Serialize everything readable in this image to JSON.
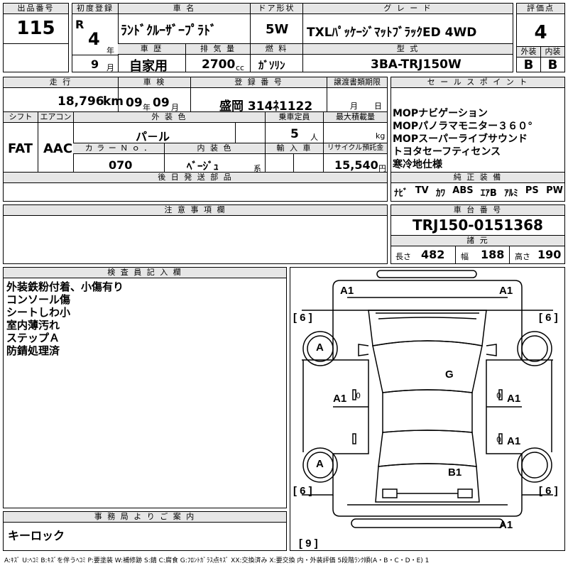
{
  "header": {
    "lot_label": "出品番号",
    "lot_no": "115",
    "first_reg_label": "初度登録",
    "era": "R",
    "year": "4",
    "year_unit": "年",
    "month": "9",
    "month_unit": "月",
    "name_label": "車 名",
    "car_name": "ﾗﾝﾄﾞｸﾙｰｻﾞｰﾌﾟﾗﾄﾞ",
    "door_label": "ドア形状",
    "door": "5W",
    "grade_label": "グ レ ー ド",
    "grade": "TXLﾊﾟｯｹｰｼﾞﾏｯﾄﾌﾞﾗｯｸED 4WD",
    "score_label": "評価点",
    "score": "4",
    "history_label": "車 歴",
    "history": "自家用",
    "displacement_label": "排 気 量",
    "displacement": "2700",
    "displacement_unit": "cc",
    "fuel_label": "燃 料",
    "fuel": "ｶﾞｿﾘﾝ",
    "model_label": "型 式",
    "model": "3BA-TRJ150W",
    "ext_label": "外装",
    "ext_grade": "B",
    "int_label": "内装",
    "int_grade": "B"
  },
  "row2": {
    "mileage_label": "走 行",
    "mileage": "18,796",
    "mileage_unit": "km",
    "inspection_label": "車 検",
    "insp_year": "09",
    "insp_year_unit": "年",
    "insp_month": "09",
    "insp_month_unit": "月",
    "plate_label": "登 録 番 号",
    "plate": "盛岡 314ﾈ1122",
    "transfer_label": "譲渡書類期限",
    "transfer_month": "月",
    "transfer_day": "日",
    "shift_label": "シフト",
    "shift": "FAT",
    "ac_label": "エアコン",
    "ac": "AAC",
    "color_label": "外 装 色",
    "color": "パ－ル",
    "capacity_label": "乗車定員",
    "capacity": "5",
    "capacity_unit": "人",
    "load_label": "最大積載量",
    "load_unit": "kg",
    "color_no_label": "カ ラ ー Ｎ ｏ ．",
    "color_no": "070",
    "interior_label": "内 装 色",
    "interior": "ﾍﾞｰｼﾞｭ",
    "interior_suffix": "系",
    "import_label": "輸 入 車",
    "recycle_label": "リサイクル預託金",
    "recycle": "15,540",
    "recycle_unit": "円",
    "delivery_label": "後 日 発 送 部 品"
  },
  "sales": {
    "label": "セ ー ル ス ポ イ ン ト",
    "points": [
      "MOPナビゲーション",
      "MOPパノラマモニター３６０°",
      "MOPスーパーライブサウンド",
      "トヨタセーフティセンス",
      "寒冷地仕様"
    ],
    "equip_label": "純 正 装 備",
    "equipment": [
      "ﾅﾋﾞ",
      "TV",
      "ｶﾜ",
      "ABS",
      "ｴｱB",
      "ｱﾙﾐ",
      "PS",
      "PW"
    ]
  },
  "caution": {
    "label": "注 意 事 項 欄"
  },
  "chassis": {
    "label": "車 台 番 号",
    "number": "TRJ150-0151368",
    "dims_label": "諸 元",
    "length_label": "長さ",
    "length": "482",
    "width_label": "幅",
    "width": "188",
    "height_label": "高さ",
    "height": "190"
  },
  "inspector": {
    "label": "検 査 員 記 入 欄",
    "notes": [
      "外装鉄粉付着、小傷有り",
      "コンソール傷",
      "シートしわ小",
      "室内薄汚れ",
      "ステップＡ",
      "防錆処理済"
    ]
  },
  "office": {
    "label": "事 務 局 よ り ご 案 内",
    "note": "キーロック"
  },
  "diagram": {
    "marks": {
      "a1_fl": "A1",
      "a1_fr": "A1",
      "six_tl": "[ 6 ]",
      "six_tr": "[ 6 ]",
      "a_front": "A",
      "g": "G",
      "a1_l": "A1",
      "a1_r1": "A1",
      "a1_r2": "A1",
      "a_rear": "A",
      "b1": "B1",
      "six_bl": "[ 6 ]",
      "six_br": "[ 6 ]",
      "a1_rear": "A1",
      "nine": "[ 9 ]",
      "zero_l": "0",
      "zero_r1": "0",
      "zero_r2": "0"
    }
  },
  "legend": "A:ｷｽﾞ U:ﾍｺﾐ B:ｷｽﾞを伴うﾍｺﾐ P:要塗装 W:補修跡 S:錆 C:腐食 G:ﾌﾛﾝﾄｶﾞﾗｽ点ｷｽﾞ XX:交換済み X:要交換 内・外装評価 5段階ﾗﾝｸ順(A・B・C・D・E) 1"
}
